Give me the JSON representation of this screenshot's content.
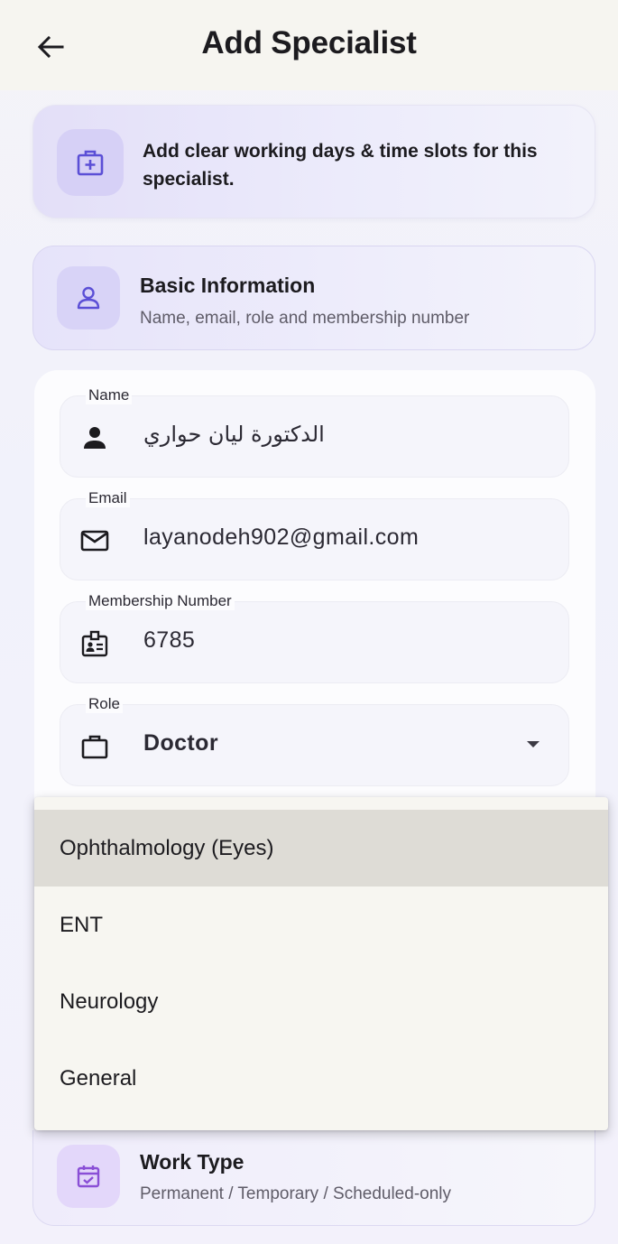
{
  "header": {
    "title": "Add Specialist",
    "back_icon": "arrow-left-icon"
  },
  "banner": {
    "text": "Add clear working days & time slots for this specialist.",
    "icon": "medical-bag-icon"
  },
  "basic_info": {
    "title": "Basic Information",
    "subtitle": "Name, email, role and membership number",
    "icon": "person-icon"
  },
  "form": {
    "name": {
      "label": "Name",
      "value": "الدكتورة ليان حواري",
      "icon": "person-filled-icon"
    },
    "email": {
      "label": "Email",
      "value": "layanodeh902@gmail.com",
      "icon": "mail-icon"
    },
    "membership": {
      "label": "Membership Number",
      "value": "6785",
      "icon": "badge-icon"
    },
    "role": {
      "label": "Role",
      "value": "Doctor",
      "icon": "briefcase-icon"
    }
  },
  "specialty_menu": {
    "items": [
      "Ophthalmology (Eyes)",
      "ENT",
      "Neurology",
      "General"
    ],
    "highlighted": "Ophthalmology (Eyes)"
  },
  "work_type": {
    "title": "Work Type",
    "subtitle": "Permanent / Temporary / Scheduled-only",
    "icon": "calendar-check-icon"
  },
  "colors": {
    "accent": "#5b4fd6",
    "icon_bg": "#d8d3f7",
    "menu_bg": "#f7f6f1",
    "menu_highlight": "#dedcd6"
  }
}
